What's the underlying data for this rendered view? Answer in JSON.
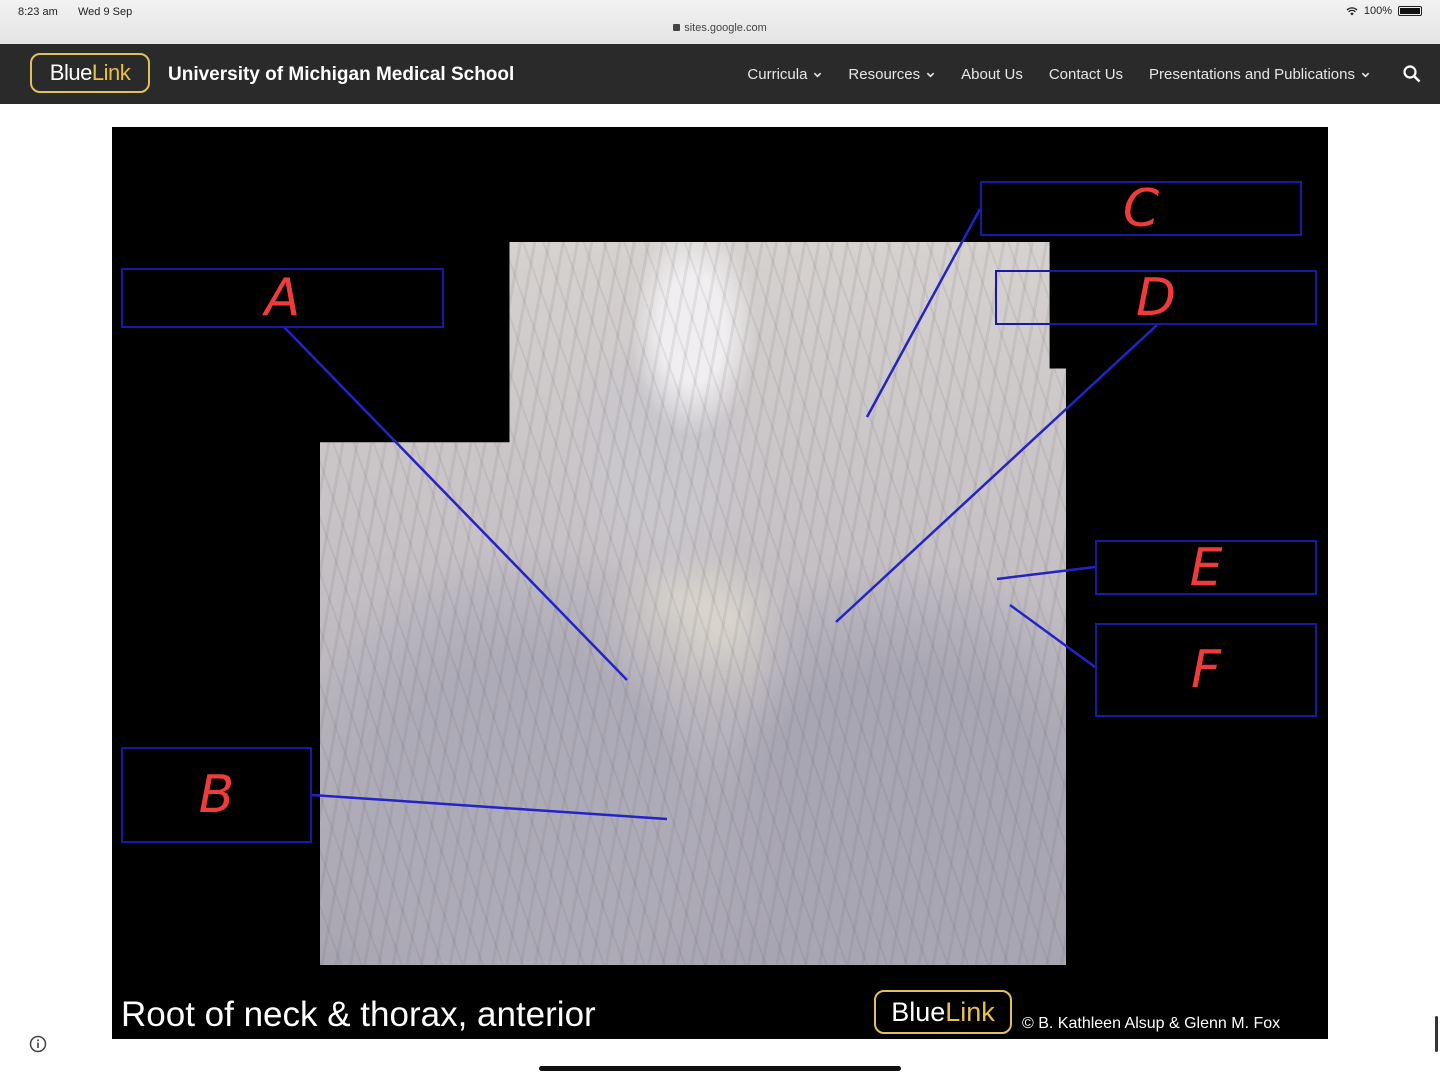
{
  "status_bar": {
    "time": "8:23 am",
    "date": "Wed 9 Sep",
    "url": "sites.google.com",
    "battery": "100%"
  },
  "navbar": {
    "logo_blue": "Blue",
    "logo_link": "Link",
    "site_title": "University of Michigan Medical School",
    "items": [
      {
        "label": "Curricula"
      },
      {
        "label": "Resources"
      },
      {
        "label": "About Us"
      },
      {
        "label": "Contact Us"
      },
      {
        "label": "Presentations and Publications"
      }
    ]
  },
  "slide": {
    "labels": [
      "A",
      "B",
      "C",
      "D",
      "E",
      "F"
    ],
    "caption": "Root of neck & thorax, anterior",
    "logo_blue": "Blue",
    "logo_link": "Link",
    "copyright": "© B. Kathleen Alsup & Glenn M. Fox"
  },
  "colors": {
    "nav_bg": "#2a2a2a",
    "logo_gold": "#e8c04a",
    "label_border": "#1a1aa0",
    "label_text": "#ee3b3b",
    "leader_line": "#2323c8"
  },
  "icons": [
    "lock-icon",
    "wifi-icon",
    "battery-icon",
    "chevron-down-icon",
    "search-icon",
    "info-icon"
  ]
}
